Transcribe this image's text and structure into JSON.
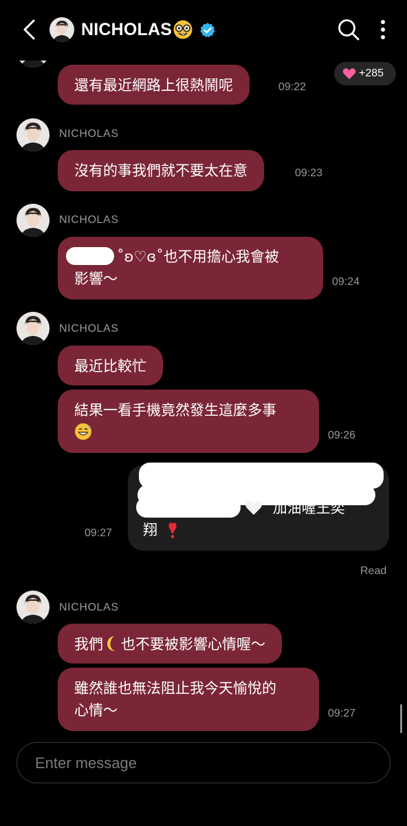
{
  "header": {
    "contact_name": "NICHOLAS",
    "name_emoji_icon": "nerd-face-icon",
    "verified_icon": "verified-badge-icon",
    "back_icon": "chevron-left-icon",
    "search_icon": "search-icon",
    "more_icon": "more-vertical-icon"
  },
  "colors": {
    "bubble_incoming": "#7a2637",
    "bubble_outgoing": "#1e1e1e",
    "verified_badge": "#35b3f0",
    "background": "#000000",
    "meta_text": "#9a9a9a"
  },
  "reaction": {
    "icon": "heart-icon",
    "count": "+285"
  },
  "messages": [
    {
      "text": "還有最近網路上很熱鬧呢",
      "time": "09:22"
    },
    {
      "sender": "NICHOLAS",
      "text": "沒有的事我們就不要太在意",
      "time": "09:23"
    },
    {
      "sender": "NICHOLAS",
      "text_line1": "˚ʚ♡ɞ˚也不用擔心我會被",
      "text_line2": "影響～",
      "time": "09:24"
    },
    {
      "sender": "NICHOLAS",
      "text": "最近比較忙"
    },
    {
      "text_line1": "結果一看手機竟然發生這麼多事",
      "emoji": "sweat-smile-icon",
      "time": "09:26"
    },
    {
      "outgoing": true,
      "text_line1": "加油喔王奕",
      "text_line2": "翔",
      "emoji_1": "white-heart-icon",
      "emoji_2": "red-exclamation-icon",
      "time": "09:27",
      "status": "Read"
    },
    {
      "sender": "NICHOLAS",
      "text_before": "我們",
      "emoji": "crescent-moon-icon",
      "text_after": "也不要被影響心情喔～"
    },
    {
      "text_line1": "雖然誰也無法阻止我今天愉悅的",
      "text_line2": "心情～",
      "time": "09:27"
    }
  ],
  "input": {
    "placeholder": "Enter message"
  }
}
